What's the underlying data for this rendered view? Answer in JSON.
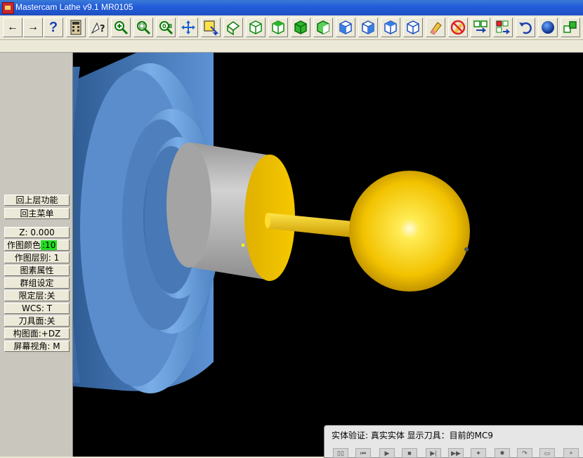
{
  "window": {
    "title": "Mastercam Lathe v9.1 MR0105"
  },
  "toolbar": {
    "icons": [
      "back-arrow-icon",
      "forward-arrow-icon",
      "help-icon",
      "calculator-icon",
      "analyze-icon",
      "zoom-icon",
      "zoom-window-icon",
      "zoom-fit-icon",
      "pan-icon",
      "select-icon",
      "dynamic-rotate-icon",
      "iso-view-icon",
      "top-view-icon",
      "front-view-icon",
      "side-view-icon",
      "cube-1-icon",
      "cube-2-icon",
      "cube-3-icon",
      "cube-4-icon",
      "eraser-icon",
      "no-eraser-icon",
      "transform-icon",
      "transform-2-icon",
      "undo-icon",
      "shade-sphere-icon",
      "cubes-icon"
    ],
    "back_label": "←",
    "forward_label": "→",
    "help_label": "?",
    "accent_color": "#0b8a0b"
  },
  "menu": {
    "items": [
      {
        "label": "回上层功能"
      },
      {
        "label": "回主菜单"
      },
      {
        "label": "Z:  0.000"
      },
      {
        "label": "作图颜色",
        "value": ":10"
      },
      {
        "label": "作图层别:  1"
      },
      {
        "label": "图素属性"
      },
      {
        "label": "群组设定"
      },
      {
        "label": "限定层:关"
      },
      {
        "label": "WCS:   T"
      },
      {
        "label": "刀具面:关"
      },
      {
        "label": "构图面:+DZ"
      },
      {
        "label": "屏幕视角:  M"
      }
    ]
  },
  "verify_window": {
    "title": "实体验证: 真实实体 显示刀具：目前的MC9",
    "controls": [
      "▯▯",
      "⏮",
      "▶",
      "■",
      "▶|",
      "▶▶",
      "✦",
      "✸",
      "↷",
      "▭",
      "+"
    ]
  },
  "colors": {
    "chuck": "#5a8fd0",
    "stock": "#b8b8b8",
    "tool": "#ffcc00",
    "background": "#000000"
  }
}
